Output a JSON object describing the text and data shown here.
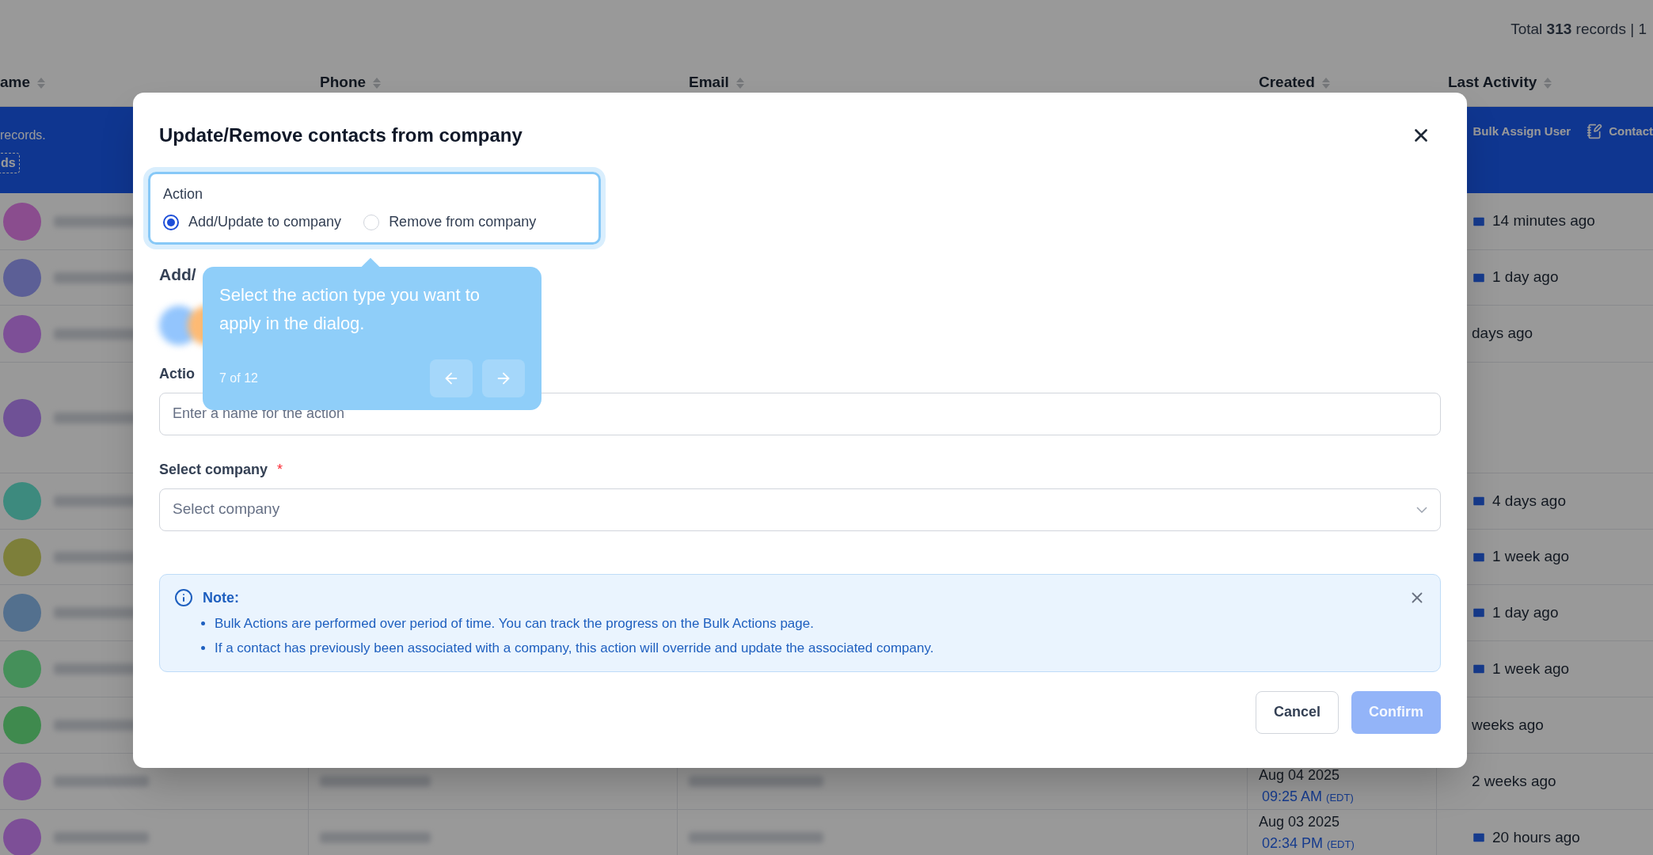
{
  "page": {
    "total_prefix": "Total",
    "total_count": "313",
    "total_suffix": "records | 1"
  },
  "table": {
    "columns": [
      "ame",
      "Phone",
      "Email",
      "Created",
      "Last Activity"
    ],
    "banner": {
      "text": "records.",
      "button": "ds",
      "actions": [
        {
          "kind": "user",
          "label": "Bulk Assign User"
        },
        {
          "kind": "note",
          "label": "Contact"
        }
      ]
    },
    "rows": [
      {
        "color": "#8a4d8e",
        "activity": "14 minutes ago",
        "kind": "envelope"
      },
      {
        "color": "#5c5f96",
        "activity": "1 day ago",
        "kind": "envelope"
      },
      {
        "color": "#7d4f97",
        "activity": "days ago",
        "kind": "plain"
      },
      {
        "color": "#6f5196",
        "kind": "plain"
      },
      {
        "color": "#3d8a7e",
        "activity": "4 days ago",
        "kind": "envelope"
      },
      {
        "color": "#7d7f3a",
        "activity": "1 week ago",
        "kind": "envelope"
      },
      {
        "color": "#53708e",
        "activity": "1 day ago",
        "kind": "envelope"
      },
      {
        "color": "#45905a",
        "activity": "1 week ago",
        "kind": "envelope"
      },
      {
        "color": "#3f8a4e",
        "activity": "weeks ago",
        "kind": "plain"
      },
      {
        "color": "#7d4f97",
        "activity": "2 weeks ago",
        "kind": "plain",
        "created_date": "Aug 04 2025",
        "created_time": "09:25 AM",
        "created_zone": "(EDT)"
      },
      {
        "color": "#7d4f97",
        "activity": "20 hours ago",
        "kind": "envelope",
        "created_date": "Aug 03 2025",
        "created_time": "02:34 PM",
        "created_zone": "(EDT)"
      }
    ]
  },
  "dialog": {
    "title": "Update/Remove contacts from company",
    "action": {
      "label": "Action",
      "options": [
        {
          "label": "Add/Update to company",
          "selected": true
        },
        {
          "label": "Remove from company",
          "selected": false
        }
      ]
    },
    "section_heading": "Add/",
    "name_field": {
      "label": "Actio",
      "placeholder": "Enter a name for the action"
    },
    "company_field": {
      "label": "Select company",
      "required_mark": "*",
      "placeholder": "Select company"
    },
    "note": {
      "title": "Note:",
      "items": [
        "Bulk Actions are performed over period of time. You can track the progress on the Bulk Actions page.",
        "If a contact has previously been associated with a company, this action will override and update the associated company."
      ]
    },
    "buttons": [
      {
        "kind": "secondary",
        "label": "Cancel",
        "disabled": false
      },
      {
        "kind": "primary",
        "label": "Confirm",
        "disabled": true
      }
    ]
  },
  "tooltip": {
    "text": "Select the action type you want to apply in the dialog.",
    "step": "7 of 12"
  }
}
